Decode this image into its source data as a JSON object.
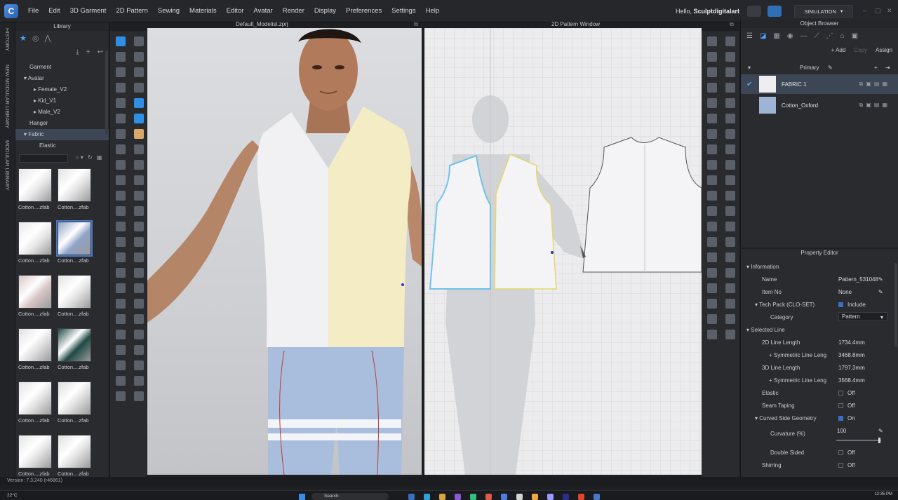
{
  "app": {
    "menu": [
      "File",
      "Edit",
      "3D Garment",
      "2D Pattern",
      "Sewing",
      "Materials",
      "Editor",
      "Avatar",
      "Render",
      "Display",
      "Preferences",
      "Settings",
      "Help"
    ],
    "greeting_prefix": "Hello,",
    "user": "Sculptdigitalart",
    "mode": "SIMULATION"
  },
  "side_tabs": [
    "HISTORY",
    "NEW MODULAR LIBRARY",
    "MODULAR LIBRARY"
  ],
  "library": {
    "title": "Library",
    "tree": [
      {
        "label": "Garment",
        "indent": 0
      },
      {
        "label": "▾ Avatar",
        "indent": 0
      },
      {
        "label": "▸ Female_V2",
        "indent": 2
      },
      {
        "label": "▸ Kid_V1",
        "indent": 2
      },
      {
        "label": "▸ Male_V2",
        "indent": 2
      },
      {
        "label": "Hanger",
        "indent": 0
      },
      {
        "label": "▾ Fabric",
        "indent": 0,
        "selected": true
      },
      {
        "label": "Elastic",
        "indent": 1
      }
    ],
    "thumbnails": [
      {
        "caption": "Cotton....zfab",
        "color": "#e6e6e6"
      },
      {
        "caption": "Cotton....zfab",
        "color": "#e2e2e2"
      },
      {
        "caption": "Cotton....zfab",
        "color": "#e8e8e8"
      },
      {
        "caption": "Cotton....zfab",
        "color": "#8fa3c8",
        "selected": true
      },
      {
        "caption": "Cotton....zfab",
        "color": "#d9c6c6"
      },
      {
        "caption": "Cotton....zfab",
        "color": "#e4e4e4"
      },
      {
        "caption": "Cotton....zfab",
        "color": "#e0e0e0"
      },
      {
        "caption": "Cotton....zfab",
        "color": "#1f4a45"
      },
      {
        "caption": "Cotton....zfab",
        "color": "#e2e2e2"
      },
      {
        "caption": "Cotton....zfab",
        "color": "#dedede"
      },
      {
        "caption": "Cotton....zfab",
        "color": "#e4e4e4"
      },
      {
        "caption": "Cotton....zfab",
        "color": "#e0e0e0"
      }
    ]
  },
  "viewport3d": {
    "title": "Default_Modelist.zprj"
  },
  "viewport2d": {
    "title": "2D Pattern Window"
  },
  "object_browser": {
    "title": "Object Browser",
    "add_label": "+ Add",
    "copy_label": "Copy",
    "assign_label": "Assign",
    "group_label": "Primary",
    "fabrics": [
      {
        "name": "FABRIC 1",
        "color": "#eeeeee",
        "selected": true
      },
      {
        "name": "Cotton_Oxford",
        "color": "#9fb3d4",
        "selected": false
      }
    ]
  },
  "property_editor": {
    "title": "Property Editor",
    "information_label": "Information",
    "name_label": "Name",
    "name_value": "Pattern_531048",
    "item_no_label": "Item No",
    "item_no_value": "None",
    "techpack_label": "Tech Pack (CLO-SET)",
    "techpack_value": "Include",
    "category_label": "Category",
    "category_value": "Pattern",
    "selected_line_label": "Selected Line",
    "line2d_label": "2D Line Length",
    "line2d_value": "1734.4mm",
    "sym2d_label": "+ Symmetric Line Leng",
    "sym2d_value": "3468.8mm",
    "line3d_label": "3D Line Length",
    "line3d_value": "1797.3mm",
    "sym3d_label": "+ Symmetric Line Leng",
    "sym3d_value": "3568.4mm",
    "elastic_label": "Elastic",
    "elastic_value": "Off",
    "seam_label": "Seam Taping",
    "seam_value": "Off",
    "curved_label": "Curved Side Geometry",
    "curved_value": "On",
    "curvature_label": "Curvature (%)",
    "curvature_value": "100",
    "double_label": "Double Sided",
    "double_value": "Off",
    "shirring_label": "Shirring",
    "shirring_value": "Off"
  },
  "status": {
    "version": "Version: 7.3.240 (r46861)"
  },
  "taskbar": {
    "weather": "22°C",
    "search": "Search",
    "time": "12:35 PM"
  }
}
